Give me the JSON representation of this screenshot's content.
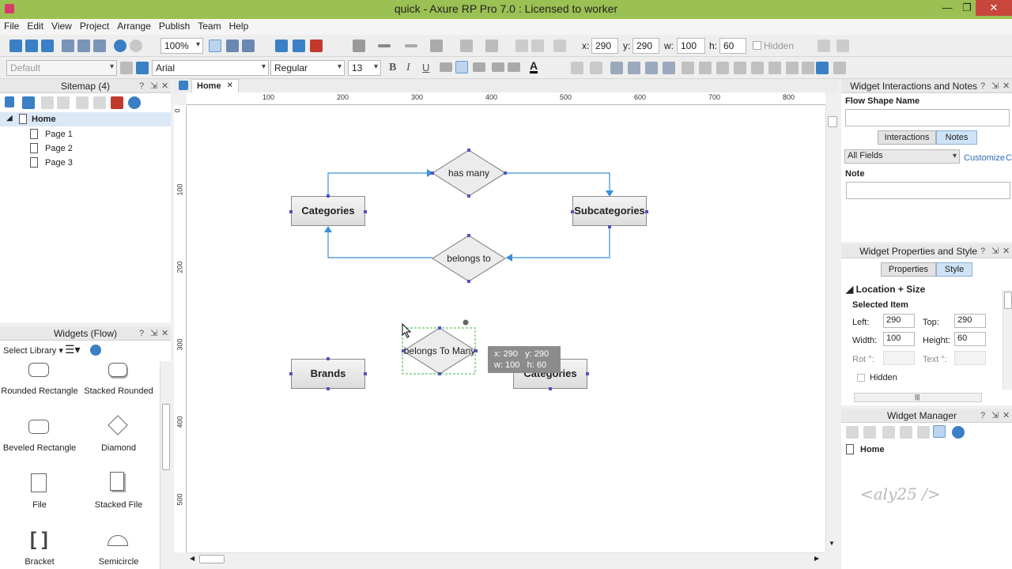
{
  "window": {
    "title": "quick - Axure RP Pro 7.0 : Licensed to worker",
    "minimize": "—",
    "restore": "❐",
    "close": "✕"
  },
  "menu": [
    "File",
    "Edit",
    "View",
    "Project",
    "Arrange",
    "Publish",
    "Team",
    "Help"
  ],
  "toolbar": {
    "zoom": "100%",
    "x_label": "x:",
    "x_value": "290",
    "y_label": "y:",
    "y_value": "290",
    "w_label": "w:",
    "w_value": "100",
    "h_label": "h:",
    "h_value": "60",
    "hidden_label": "Hidden"
  },
  "format_bar": {
    "style": "Default",
    "font": "Arial",
    "weight": "Regular",
    "size": "13"
  },
  "sitemap": {
    "title": "Sitemap (4)",
    "root": "Home",
    "pages": [
      "Page 1",
      "Page 2",
      "Page 3"
    ]
  },
  "widgets": {
    "title": "Widgets (Flow)",
    "select_library": "Select Library",
    "items": [
      "Rounded Rectangle",
      "Stacked Rounded",
      "Beveled Rectangle",
      "Diamond",
      "File",
      "Stacked File",
      "Bracket",
      "Semicircle"
    ]
  },
  "editor": {
    "tab": "Home",
    "ruler_h": [
      "100",
      "200",
      "300",
      "400",
      "500",
      "600",
      "700",
      "800"
    ],
    "ruler_v": [
      "0",
      "100",
      "200",
      "300",
      "400",
      "500"
    ],
    "shapes": {
      "categories_top": "Categories",
      "has_many": "has many",
      "subcategories": "Subcategories",
      "belongs_to": "belongs to",
      "brands": "Brands",
      "belongs_to_many": "belongs To Many",
      "categories_bottom": "Categories"
    },
    "tooltip": {
      "x": "x: 290",
      "y": "y: 290",
      "w": "w: 100",
      "h": "h: 60"
    }
  },
  "interactions": {
    "title": "Widget Interactions and Notes",
    "flow_shape_name": "Flow Shape Name",
    "tab_interactions": "Interactions",
    "tab_notes": "Notes",
    "fields": "All Fields",
    "customize": "Customize",
    "customize_extra": "Cl",
    "note": "Note"
  },
  "properties": {
    "title": "Widget Properties and Style",
    "tab_properties": "Properties",
    "tab_style": "Style",
    "section": "Location + Size",
    "selected_item": "Selected Item",
    "left_label": "Left:",
    "left_value": "290",
    "top_label": "Top:",
    "top_value": "290",
    "width_label": "Width:",
    "width_value": "100",
    "height_label": "Height:",
    "height_value": "60",
    "rot_label": "Rot °:",
    "text_label": "Text °:",
    "hidden_label": "Hidden"
  },
  "manager": {
    "title": "Widget Manager",
    "root": "Home",
    "watermark": "<aly25 />"
  }
}
